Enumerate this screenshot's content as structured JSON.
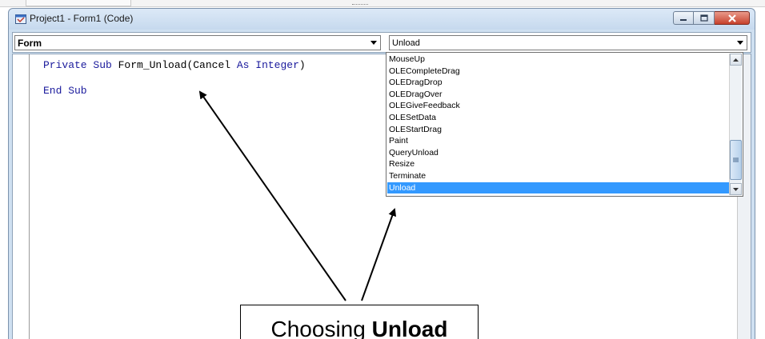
{
  "window": {
    "title": "Project1 - Form1 (Code)"
  },
  "object_combo": {
    "value": "Form"
  },
  "procedure_combo": {
    "value": "Unload"
  },
  "code": {
    "lines": [
      {
        "kw1": "Private Sub ",
        "text": "Form_Unload(Cancel ",
        "kw2": "As Integer",
        "end": ")"
      },
      {
        "kw1": "End Sub"
      }
    ]
  },
  "procedure_list": {
    "items": [
      "MouseUp",
      "OLECompleteDrag",
      "OLEDragDrop",
      "OLEDragOver",
      "OLEGiveFeedback",
      "OLESetData",
      "OLEStartDrag",
      "Paint",
      "QueryUnload",
      "Resize",
      "Terminate",
      "Unload"
    ],
    "selected": "Unload"
  },
  "annotation": {
    "prefix": "Choosing ",
    "bold": "Unload"
  },
  "colors": {
    "selection": "#3399ff",
    "keyword": "#1a1a9c",
    "close_button": "#c7412d"
  }
}
